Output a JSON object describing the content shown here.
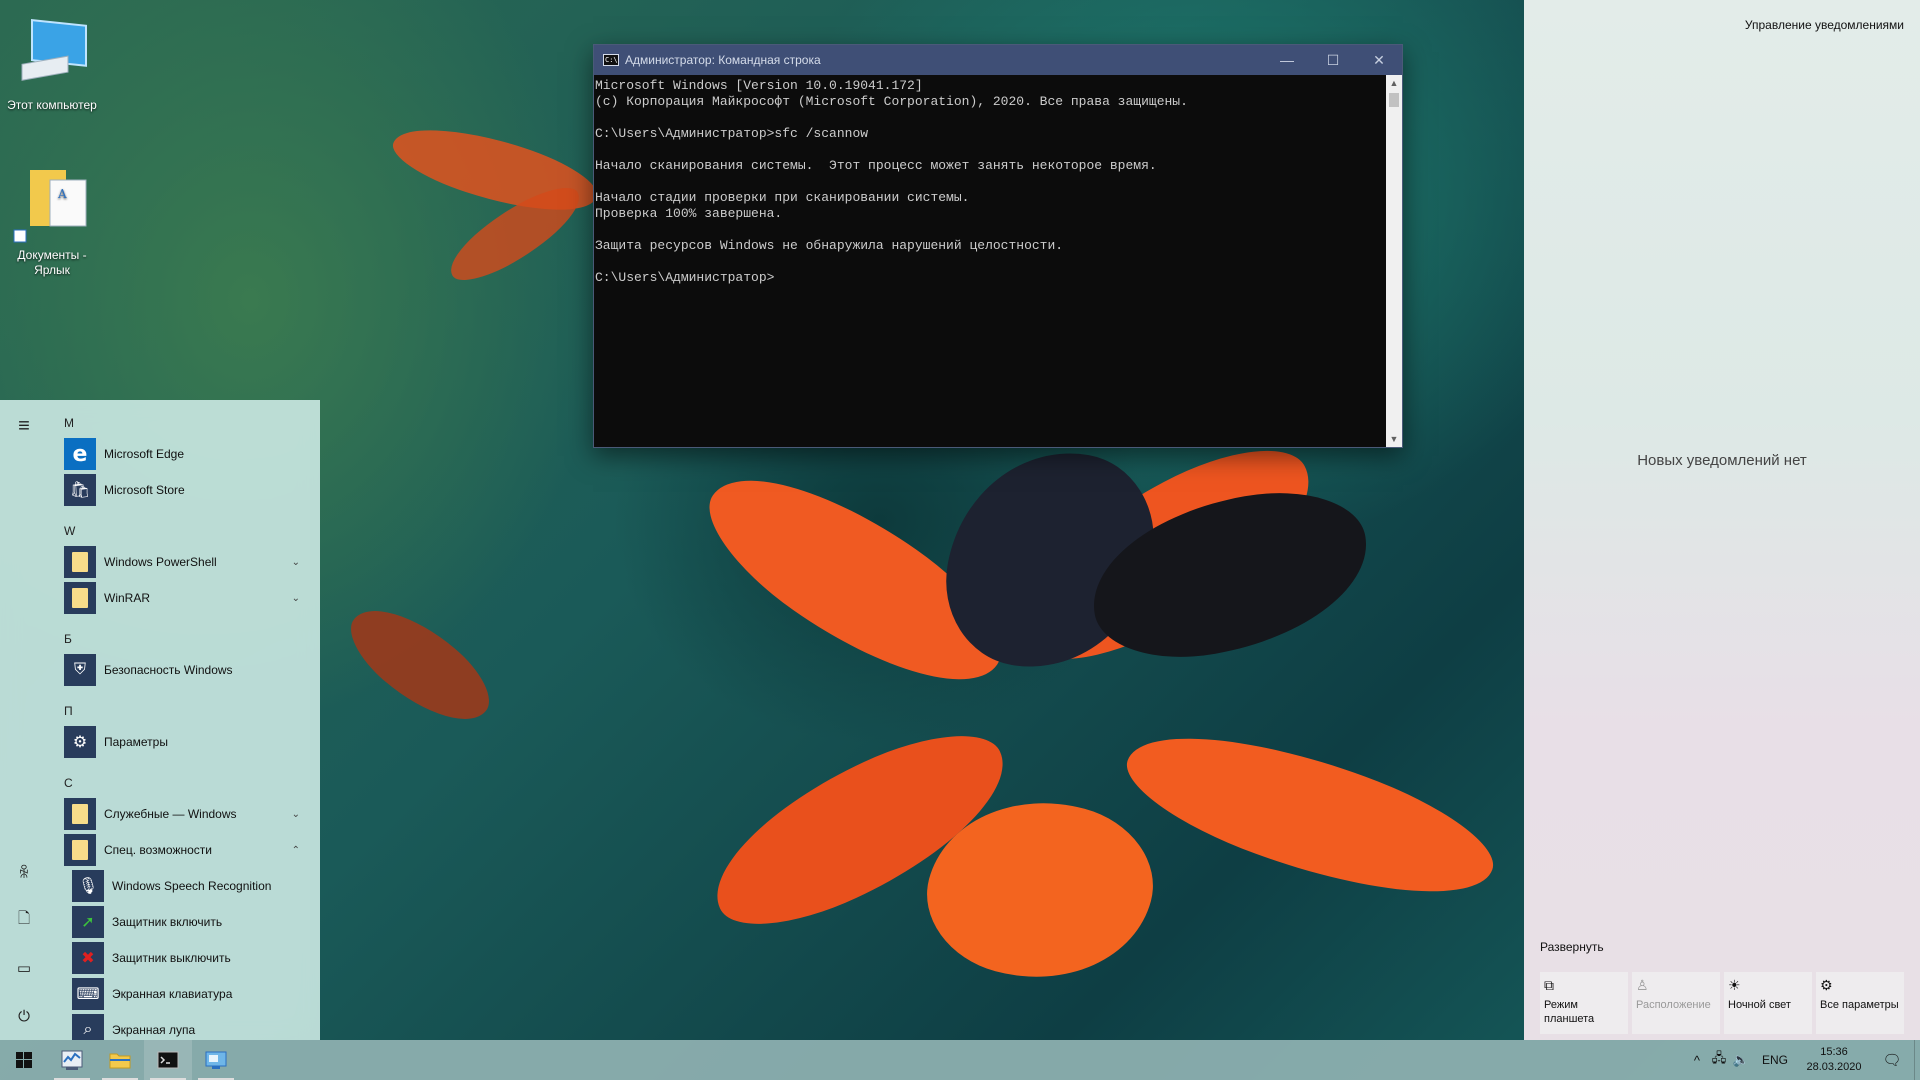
{
  "desktop": {
    "icons": [
      {
        "label": "Этот компьютер",
        "icon": "computer-icon"
      },
      {
        "label": "Документы - Ярлык",
        "icon": "folder-shortcut-icon"
      }
    ]
  },
  "console": {
    "title": "Администратор: Командная строка",
    "lines": [
      "Microsoft Windows [Version 10.0.19041.172]",
      "(c) Корпорация Майкрософт (Microsoft Corporation), 2020. Все права защищены.",
      "",
      "C:\\Users\\Администратор>sfc /scannow",
      "",
      "Начало сканирования системы.  Этот процесс может занять некоторое время.",
      "",
      "Начало стадии проверки при сканировании системы.",
      "Проверка 100% завершена.",
      "",
      "Защита ресурсов Windows не обнаружила нарушений целостности.",
      "",
      "C:\\Users\\Администратор>"
    ],
    "minimize_glyph": "—",
    "maximize_glyph": "☐",
    "close_glyph": "✕"
  },
  "start_menu": {
    "rail": {
      "hamburger": "≡",
      "user": "ꆜ",
      "documents": "🗋",
      "pictures": "▭",
      "power": "⏻"
    },
    "groups": [
      {
        "letter": "M",
        "items": [
          {
            "label": "Microsoft Edge",
            "icon": "edge-icon",
            "tile_color": "#0a6fc2"
          },
          {
            "label": "Microsoft Store",
            "icon": "store-icon",
            "tile_color": "#283c5c"
          }
        ]
      },
      {
        "letter": "W",
        "items": [
          {
            "label": "Windows PowerShell",
            "icon": "folder-icon",
            "tile_color": "#283c5c",
            "expand": "⌄"
          },
          {
            "label": "WinRAR",
            "icon": "folder-icon",
            "tile_color": "#283c5c",
            "expand": "⌄"
          }
        ]
      },
      {
        "letter": "Б",
        "items": [
          {
            "label": "Безопасность Windows",
            "icon": "shield-icon",
            "tile_color": "#283c5c"
          }
        ]
      },
      {
        "letter": "П",
        "items": [
          {
            "label": "Параметры",
            "icon": "gear-icon",
            "tile_color": "#283c5c"
          }
        ]
      },
      {
        "letter": "С",
        "items": [
          {
            "label": "Служебные — Windows",
            "icon": "folder-icon",
            "tile_color": "#283c5c",
            "expand": "⌄"
          },
          {
            "label": "Спец. возможности",
            "icon": "folder-icon",
            "tile_color": "#283c5c",
            "expand": "⌃"
          }
        ]
      }
    ],
    "sub_items": [
      {
        "label": "Windows Speech Recognition",
        "icon": "microphone-icon"
      },
      {
        "label": "Защитник включить",
        "icon": "green-arrow-icon"
      },
      {
        "label": "Защитник выключить",
        "icon": "red-x-icon"
      },
      {
        "label": "Экранная клавиатура",
        "icon": "keyboard-icon"
      },
      {
        "label": "Экранная лупа",
        "icon": "magnifier-icon"
      }
    ]
  },
  "action_center": {
    "manage": "Управление уведомлениями",
    "empty": "Новых уведомлений нет",
    "expand": "Развернуть",
    "quick_actions": [
      {
        "label": "Режим планшета",
        "icon": "tablet-mode-icon",
        "glyph": "⧉",
        "enabled": true
      },
      {
        "label": "Расположение",
        "icon": "location-icon",
        "glyph": "♙",
        "enabled": false
      },
      {
        "label": "Ночной свет",
        "icon": "night-light-icon",
        "glyph": "☀",
        "enabled": true
      },
      {
        "label": "Все параметры",
        "icon": "settings-icon",
        "glyph": "⚙",
        "enabled": true
      }
    ]
  },
  "taskbar": {
    "apps": [
      {
        "name": "task-manager",
        "running": true
      },
      {
        "name": "file-explorer",
        "running": true
      },
      {
        "name": "command-prompt",
        "running": true
      },
      {
        "name": "remote-desktop",
        "running": true
      }
    ],
    "tray": {
      "chevron": "^",
      "network": "🖧",
      "volume": "🔈",
      "language": "ENG",
      "time": "15:36",
      "date": "28.03.2020",
      "notification_glyph": "🗨"
    }
  },
  "colors": {
    "console_title_bg": "#3f4f76",
    "console_bg": "#0c0c0c",
    "console_text": "#cccccc",
    "taskbar": "#8cafaf",
    "start_menu": "#c8e6e1"
  }
}
